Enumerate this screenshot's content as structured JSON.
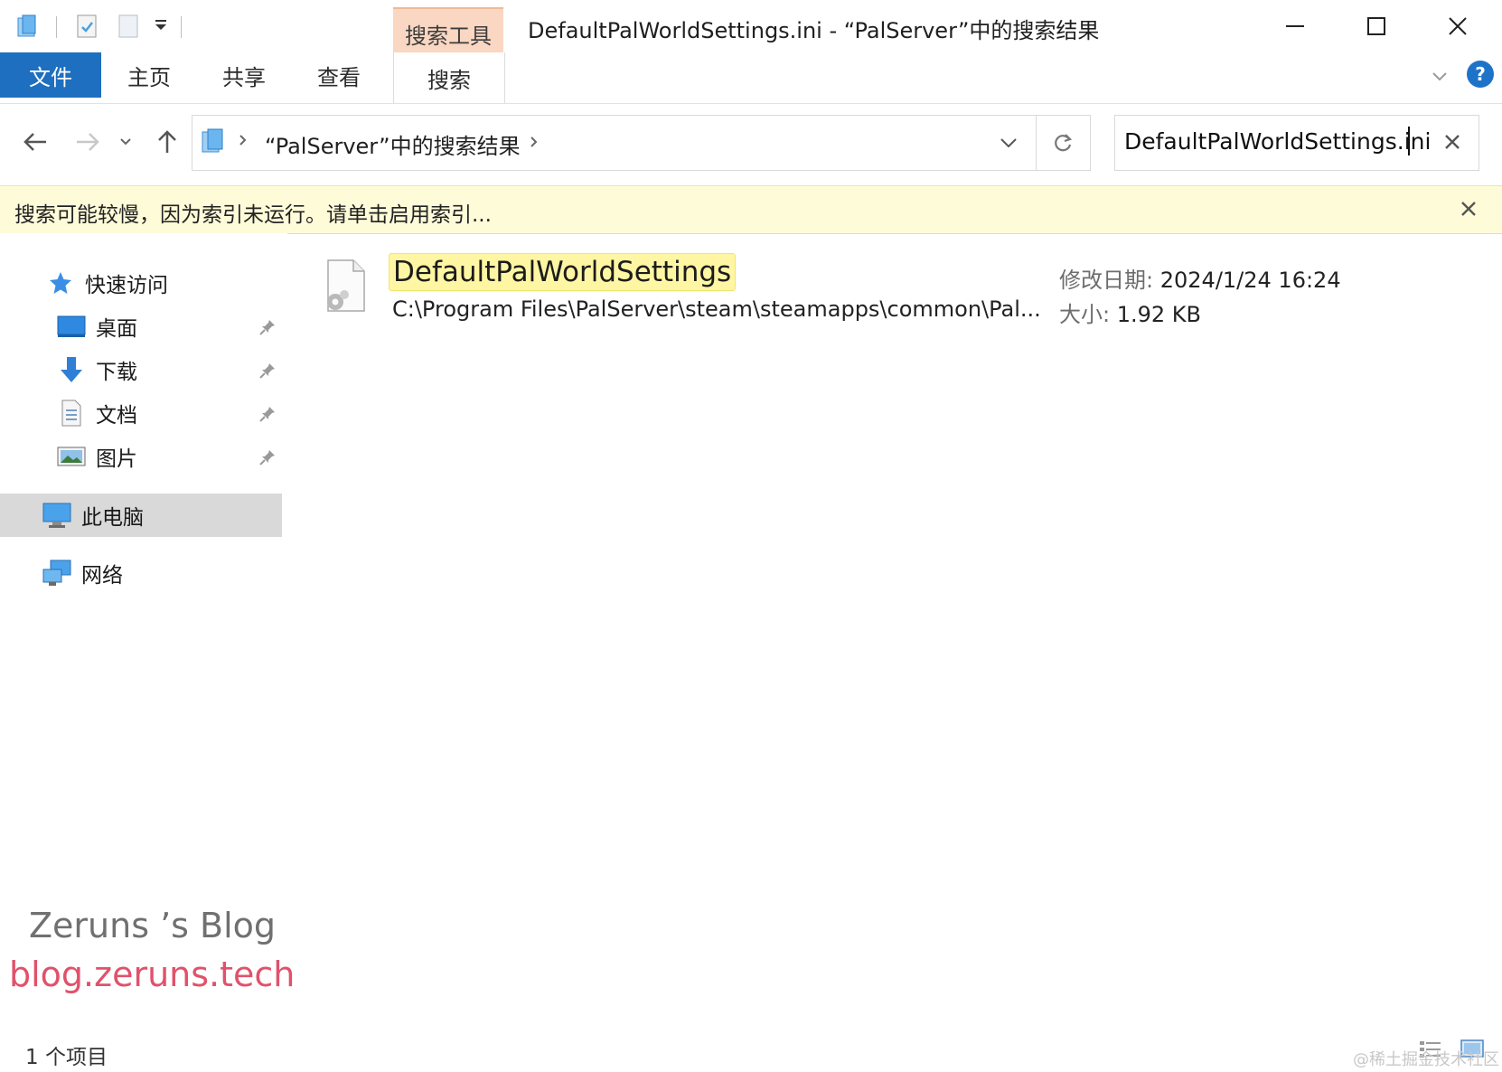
{
  "window": {
    "title": "DefaultPalWorldSettings.ini - “PalServer”中的搜索结果",
    "context_tab_header": "搜索工具"
  },
  "ribbon": {
    "tabs": [
      "文件",
      "主页",
      "共享",
      "查看",
      "搜索"
    ],
    "active_tab": "文件",
    "accent_color": "#1e6fbf"
  },
  "address": {
    "breadcrumb": "“PalServer”中的搜索结果"
  },
  "search": {
    "value": "DefaultPalWorldSettings.ini"
  },
  "infobar": {
    "message": "搜索可能较慢，因为索引未运行。请单击启用索引..."
  },
  "sidebar": {
    "quick_access": "快速访问",
    "pinned": [
      {
        "label": "桌面",
        "icon": "desktop-icon"
      },
      {
        "label": "下载",
        "icon": "download-icon"
      },
      {
        "label": "文档",
        "icon": "document-icon"
      },
      {
        "label": "图片",
        "icon": "pictures-icon"
      }
    ],
    "this_pc": "此电脑",
    "network": "网络"
  },
  "result": {
    "name": "DefaultPalWorldSettings",
    "path": "C:\\Program Files\\PalServer\\steam\\steamapps\\common\\Pal...",
    "date_label": "修改日期:",
    "date_value": "2024/1/24 16:24",
    "size_label": "大小:",
    "size_value": "1.92 KB"
  },
  "status": {
    "item_count": "1 个项目"
  },
  "watermarks": {
    "blog_title": "Zeruns ’s Blog",
    "blog_url": "blog.zeruns.tech",
    "site": "@稀土掘金技术社区"
  }
}
